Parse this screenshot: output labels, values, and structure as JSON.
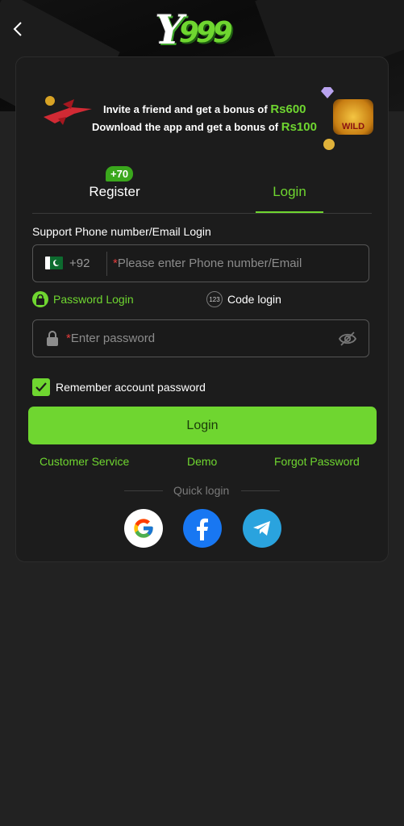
{
  "header": {
    "logo_text": "Y999",
    "logo_letter": "Y",
    "logo_number": "999"
  },
  "banner": {
    "line1_text": "Invite a friend and get a bonus of",
    "line1_amount": "Rs600",
    "line2_text": "Download the app and get a bonus of",
    "line2_amount": "Rs100",
    "wild_label": "WILD"
  },
  "tabs": {
    "register_label": "Register",
    "register_badge": "+70",
    "login_label": "Login",
    "active": "login"
  },
  "form": {
    "section_label": "Support Phone number/Email Login",
    "country_code": "+92",
    "phone_placeholder": "Please enter Phone number/Email",
    "password_placeholder": "Enter password",
    "required_mark": "*",
    "password_login_label": "Password Login",
    "code_login_label": "Code login",
    "code_icon_text": "123",
    "remember_label": "Remember account password",
    "remember_checked": true,
    "login_button": "Login"
  },
  "links": {
    "customer_service": "Customer Service",
    "demo": "Demo",
    "forgot_password": "Forgot Password"
  },
  "quick_login": {
    "label": "Quick login",
    "providers": [
      "google-icon",
      "facebook-icon",
      "telegram-icon"
    ]
  },
  "colors": {
    "accent": "#6fd630",
    "background": "#222222",
    "card": "#1c1c1c",
    "required": "#e43b3b"
  }
}
